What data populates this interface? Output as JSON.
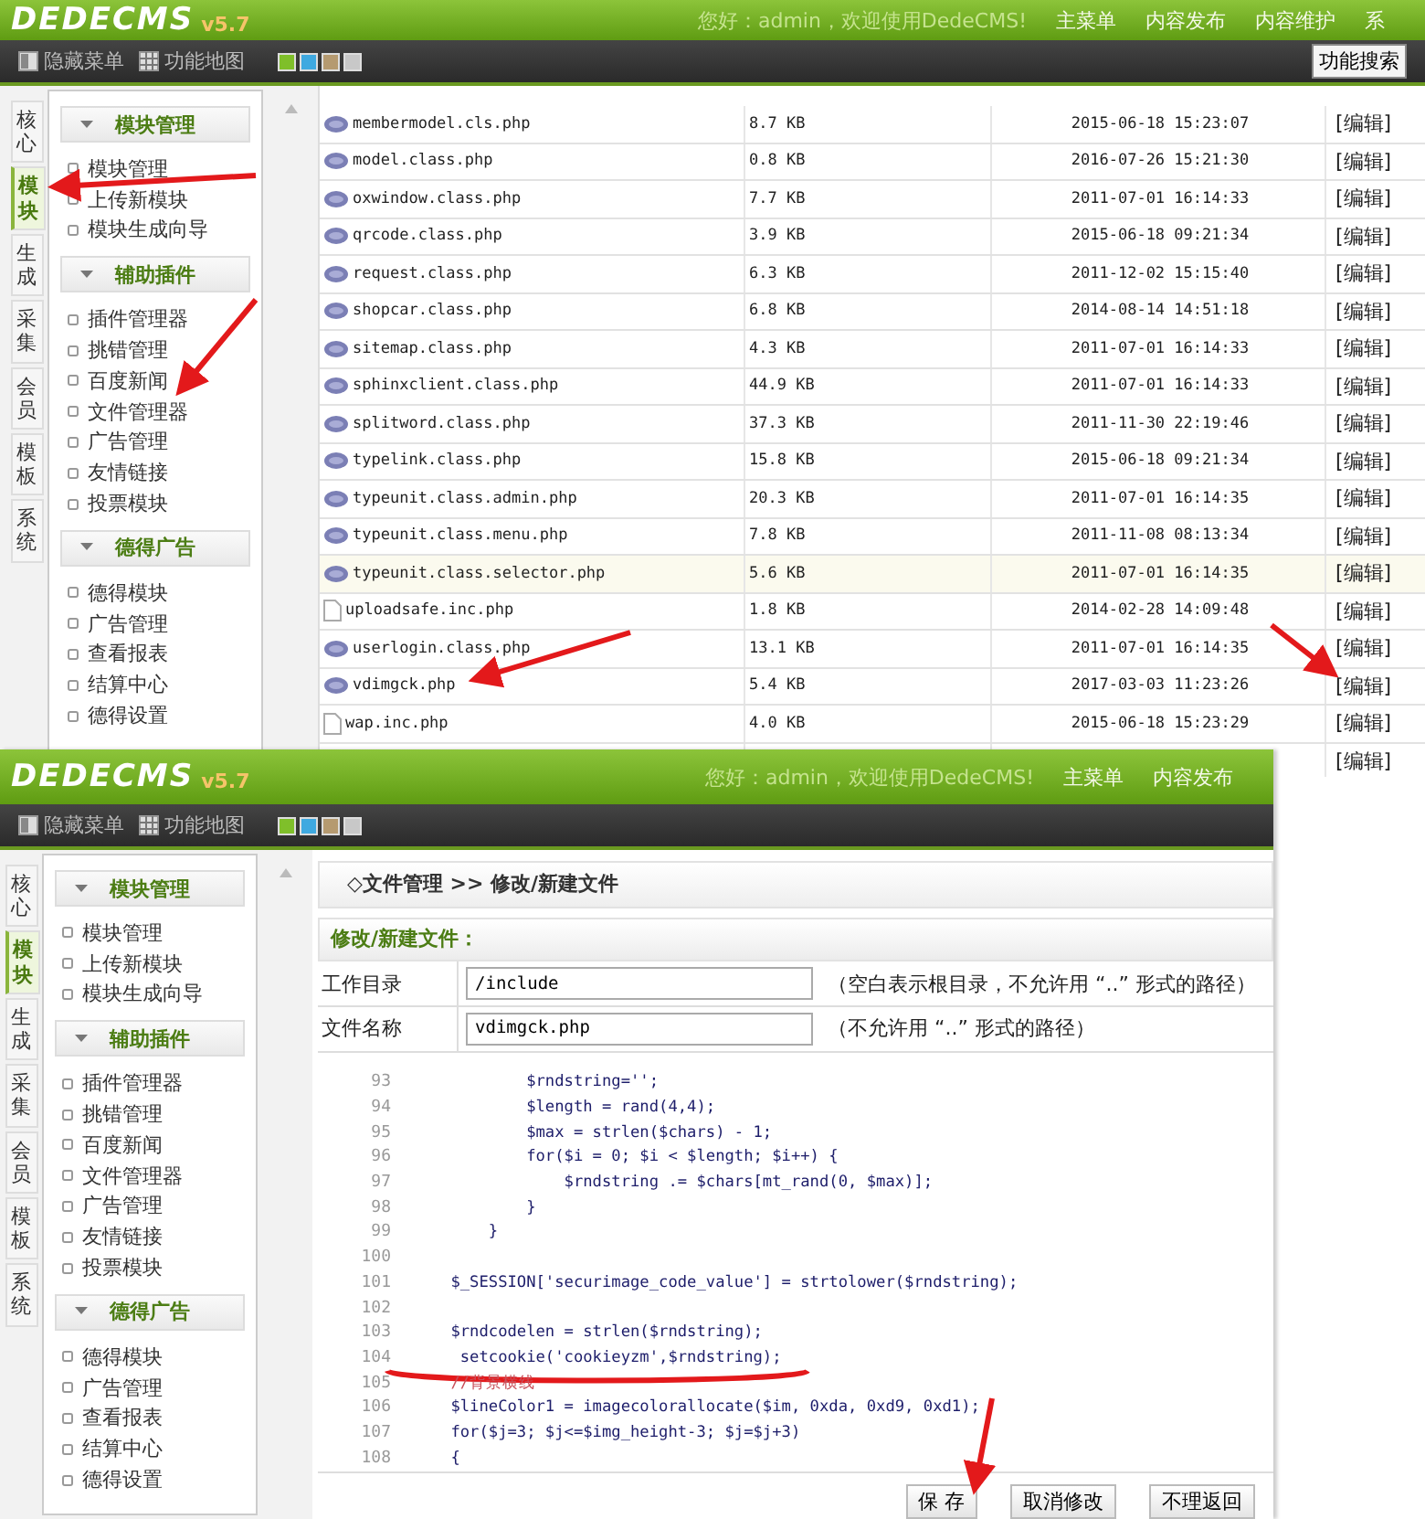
{
  "top_screen": {
    "header": {
      "logo": "DEDECMS",
      "version": "v5.7",
      "welcome": "您好：admin，欢迎使用DedeCMS!",
      "menu": [
        "主菜单",
        "内容发布",
        "内容维护",
        "系"
      ]
    },
    "toolbar": {
      "items": [
        "隐藏菜单",
        "功能地图"
      ],
      "search_button": "功能搜索"
    },
    "side_tabs": [
      {
        "label": "核心",
        "selected": false
      },
      {
        "label": "模块",
        "selected": true
      },
      {
        "label": "生成",
        "selected": false
      },
      {
        "label": "采集",
        "selected": false
      },
      {
        "label": "会员",
        "selected": false
      },
      {
        "label": "模板",
        "selected": false
      },
      {
        "label": "系统",
        "selected": false
      }
    ],
    "sidebar": [
      {
        "title": "模块管理",
        "items": [
          "模块管理",
          "上传新模块",
          "模块生成向导"
        ]
      },
      {
        "title": "辅助插件",
        "items": [
          "插件管理器",
          "挑错管理",
          "百度新闻",
          "文件管理器",
          "广告管理",
          "友情链接",
          "投票模块"
        ]
      },
      {
        "title": "德得广告",
        "items": [
          "德得模块",
          "广告管理",
          "查看报表",
          "结算中心",
          "德得设置"
        ]
      }
    ],
    "file_table": {
      "rows": [
        {
          "kind": "php",
          "name": "membermodel.cls.php",
          "size": "8.7 KB",
          "modified": "2015-06-18 15:23:07",
          "edit": "[编辑]",
          "highlighted": false
        },
        {
          "kind": "php",
          "name": "model.class.php",
          "size": "0.8 KB",
          "modified": "2016-07-26 15:21:30",
          "edit": "[编辑]",
          "highlighted": false
        },
        {
          "kind": "php",
          "name": "oxwindow.class.php",
          "size": "7.7 KB",
          "modified": "2011-07-01 16:14:33",
          "edit": "[编辑]",
          "highlighted": false
        },
        {
          "kind": "php",
          "name": "qrcode.class.php",
          "size": "3.9 KB",
          "modified": "2015-06-18 09:21:34",
          "edit": "[编辑]",
          "highlighted": false
        },
        {
          "kind": "php",
          "name": "request.class.php",
          "size": "6.3 KB",
          "modified": "2011-12-02 15:15:40",
          "edit": "[编辑]",
          "highlighted": false
        },
        {
          "kind": "php",
          "name": "shopcar.class.php",
          "size": "6.8 KB",
          "modified": "2014-08-14 14:51:18",
          "edit": "[编辑]",
          "highlighted": false
        },
        {
          "kind": "php",
          "name": "sitemap.class.php",
          "size": "4.3 KB",
          "modified": "2011-07-01 16:14:33",
          "edit": "[编辑]",
          "highlighted": false
        },
        {
          "kind": "php",
          "name": "sphinxclient.class.php",
          "size": "44.9 KB",
          "modified": "2011-07-01 16:14:33",
          "edit": "[编辑]",
          "highlighted": false
        },
        {
          "kind": "php",
          "name": "splitword.class.php",
          "size": "37.3 KB",
          "modified": "2011-11-30 22:19:46",
          "edit": "[编辑]",
          "highlighted": false
        },
        {
          "kind": "php",
          "name": "typelink.class.php",
          "size": "15.8 KB",
          "modified": "2015-06-18 09:21:34",
          "edit": "[编辑]",
          "highlighted": false
        },
        {
          "kind": "php",
          "name": "typeunit.class.admin.php",
          "size": "20.3 KB",
          "modified": "2011-07-01 16:14:35",
          "edit": "[编辑]",
          "highlighted": false
        },
        {
          "kind": "php",
          "name": "typeunit.class.menu.php",
          "size": "7.8 KB",
          "modified": "2011-11-08 08:13:34",
          "edit": "[编辑]",
          "highlighted": false
        },
        {
          "kind": "php",
          "name": "typeunit.class.selector.php",
          "size": "5.6 KB",
          "modified": "2011-07-01 16:14:35",
          "edit": "[编辑]",
          "highlighted": true
        },
        {
          "kind": "file",
          "name": "uploadsafe.inc.php",
          "size": "1.8 KB",
          "modified": "2014-02-28 14:09:48",
          "edit": "[编辑]",
          "highlighted": false
        },
        {
          "kind": "php",
          "name": "userlogin.class.php",
          "size": "13.1 KB",
          "modified": "2011-07-01 16:14:35",
          "edit": "[编辑]",
          "highlighted": false
        },
        {
          "kind": "php",
          "name": "vdimgck.php",
          "size": "5.4 KB",
          "modified": "2017-03-03 11:23:26",
          "edit": "[编辑]",
          "highlighted": false
        },
        {
          "kind": "file",
          "name": "wap.inc.php",
          "size": "4.0 KB",
          "modified": "2015-06-18 15:23:29",
          "edit": "[编辑]",
          "highlighted": false
        },
        {
          "kind": "covered",
          "edit": "[编辑]",
          "highlighted": false
        }
      ]
    }
  },
  "bottom_screen": {
    "header": {
      "logo": "DEDECMS",
      "version": "v5.7",
      "welcome": "您好：admin，欢迎使用DedeCMS!",
      "menu": [
        "主菜单",
        "内容发布"
      ]
    },
    "toolbar": {
      "items": [
        "隐藏菜单",
        "功能地图"
      ]
    },
    "side_tabs": [
      {
        "label": "核心",
        "selected": false
      },
      {
        "label": "模块",
        "selected": true
      },
      {
        "label": "生成",
        "selected": false
      },
      {
        "label": "采集",
        "selected": false
      },
      {
        "label": "会员",
        "selected": false
      },
      {
        "label": "模板",
        "selected": false
      },
      {
        "label": "系统",
        "selected": false
      }
    ],
    "sidebar": [
      {
        "title": "模块管理",
        "items": [
          "模块管理",
          "上传新模块",
          "模块生成向导"
        ]
      },
      {
        "title": "辅助插件",
        "items": [
          "插件管理器",
          "挑错管理",
          "百度新闻",
          "文件管理器",
          "广告管理",
          "友情链接",
          "投票模块"
        ]
      },
      {
        "title": "德得广告",
        "items": [
          "德得模块",
          "广告管理",
          "查看报表",
          "结算中心",
          "德得设置"
        ]
      }
    ],
    "breadcrumb": "◇文件管理 >> 修改/新建文件",
    "form_title": "修改/新建文件：",
    "fields": [
      {
        "label": "工作目录",
        "value": "/include",
        "hint": "（空白表示根目录，不允许用 “..” 形式的路径）"
      },
      {
        "label": "文件名称",
        "value": "vdimgck.php",
        "hint": "（不允许用 “..” 形式的路径）"
      }
    ],
    "code_lines": [
      {
        "kind": "code",
        "number": "93",
        "text": "            $rndstring='';"
      },
      {
        "kind": "code",
        "number": "94",
        "text": "            $length = rand(4,4);"
      },
      {
        "kind": "code",
        "number": "95",
        "text": "            $max = strlen($chars) - 1;"
      },
      {
        "kind": "code",
        "number": "96",
        "text": "            for($i = 0; $i < $length; $i++) {"
      },
      {
        "kind": "code",
        "number": "97",
        "text": "                $rndstring .= $chars[mt_rand(0, $max)];"
      },
      {
        "kind": "code",
        "number": "98",
        "text": "            }"
      },
      {
        "kind": "code",
        "number": "99",
        "text": "        }"
      },
      {
        "kind": "blank",
        "number": "100"
      },
      {
        "kind": "code",
        "number": "101",
        "text": "    $_SESSION['securimage_code_value'] = strtolower($rndstring);"
      },
      {
        "kind": "blank",
        "number": "102"
      },
      {
        "kind": "code",
        "number": "103",
        "text": "    $rndcodelen = strlen($rndstring);"
      },
      {
        "kind": "code",
        "number": "104",
        "text": "     setcookie('cookieyzm',$rndstring);"
      },
      {
        "kind": "comment",
        "number": "105",
        "text": "    //背景横线"
      },
      {
        "kind": "code",
        "number": "106",
        "text": "    $lineColor1 = imagecolorallocate($im, 0xda, 0xd9, 0xd1);"
      },
      {
        "kind": "code",
        "number": "107",
        "text": "    for($j=3; $j<=$img_height-3; $j=$j+3)"
      },
      {
        "kind": "code",
        "number": "108",
        "text": "    {"
      }
    ],
    "buttons": [
      "保 存",
      "取消修改",
      "不理返回"
    ]
  }
}
